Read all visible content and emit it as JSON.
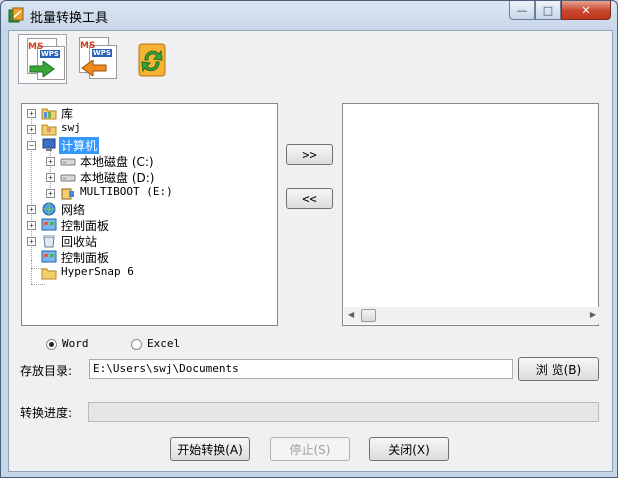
{
  "window": {
    "title": "批量转换工具",
    "controls": {
      "minimize": "—",
      "maximize": "□",
      "close": "✕"
    }
  },
  "toolbar": {
    "items": [
      {
        "icon": "ms-to-wps-icon",
        "badge_ms": "MS",
        "badge_wps": "WPS",
        "active": true
      },
      {
        "icon": "wps-to-ms-icon",
        "badge_ms": "MS",
        "badge_wps": "WPS",
        "active": false
      },
      {
        "icon": "refresh-arrows-icon",
        "active": false
      }
    ]
  },
  "tree": {
    "items": [
      {
        "label": "库",
        "icon": "library-icon",
        "expander": "+"
      },
      {
        "label": "swj",
        "icon": "user-folder-icon",
        "expander": "+"
      },
      {
        "label": "计算机",
        "icon": "computer-icon",
        "expander": "−",
        "selected": true
      },
      {
        "label": "本地磁盘 (C:)",
        "icon": "drive-icon",
        "expander": "+"
      },
      {
        "label": "本地磁盘 (D:)",
        "icon": "drive-icon",
        "expander": "+"
      },
      {
        "label": "MULTIBOOT (E:)",
        "icon": "usb-drive-icon",
        "expander": "+"
      },
      {
        "label": "网络",
        "icon": "network-icon",
        "expander": "+"
      },
      {
        "label": "控制面板",
        "icon": "control-panel-icon",
        "expander": "+"
      },
      {
        "label": "回收站",
        "icon": "recycle-bin-icon",
        "expander": "+"
      },
      {
        "label": "控制面板",
        "icon": "control-panel-icon"
      },
      {
        "label": "HyperSnap 6",
        "icon": "folder-icon"
      }
    ]
  },
  "transfer": {
    "add_label": ">>",
    "remove_label": "<<"
  },
  "scroll": {
    "left": "◀",
    "right": "▶"
  },
  "format": {
    "options": [
      {
        "label": "Word",
        "selected": true
      },
      {
        "label": "Excel",
        "selected": false
      }
    ]
  },
  "save_dir": {
    "label": "存放目录:",
    "value": "E:\\Users\\swj\\Documents",
    "browse_label": "浏 览(B)"
  },
  "progress": {
    "label": "转换进度:",
    "value": 0
  },
  "actions": {
    "start_label": "开始转换(A)",
    "stop_label": "停止(S)",
    "close_label": "关闭(X)"
  },
  "colors": {
    "selection": "#3399ff",
    "titlebar": "#dbe6f3",
    "close": "#c7452a"
  }
}
